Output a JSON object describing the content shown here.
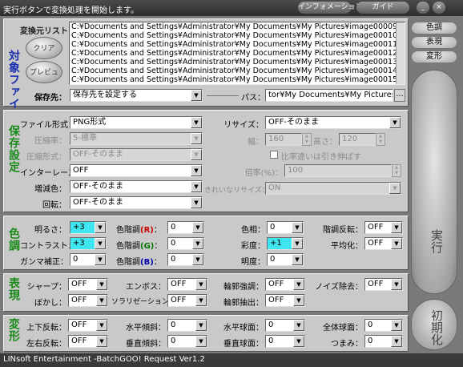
{
  "title": "実行ボタンで変換処理を開始します。",
  "header_buttons": {
    "info": "インフォメーション",
    "guide": "ガイド"
  },
  "side": {
    "tone": "色調",
    "display": "表現",
    "transform": "変形",
    "execute": "実行",
    "reset": "初期化"
  },
  "file": {
    "section": "対象ファイル",
    "list_label": "変換元リスト:",
    "clear": "クリア",
    "preview": "プレビュー",
    "items": [
      "C:¥Documents and Settings¥Administrator¥My Documents¥My Pictures¥image00009",
      "C:¥Documents and Settings¥Administrator¥My Documents¥My Pictures¥image00010",
      "C:¥Documents and Settings¥Administrator¥My Documents¥My Pictures¥image00011",
      "C:¥Documents and Settings¥Administrator¥My Documents¥My Pictures¥image00012",
      "C:¥Documents and Settings¥Administrator¥My Documents¥My Pictures¥image00013",
      "C:¥Documents and Settings¥Administrator¥My Documents¥My Pictures¥image00014",
      "C:¥Documents and Settings¥Administrator¥My Documents¥My Pictures¥image00015"
    ],
    "dest_label": "保存先：",
    "dest_value": "保存先を設定する",
    "path_label": "パス：",
    "path_value": "tor¥My Documents¥My Pictures",
    "browse": "..."
  },
  "save": {
    "section": "保存設定",
    "format_label": "ファイル形式：",
    "format_value": "PNG形式",
    "comp_rate_label": "圧縮率：",
    "comp_rate_value": "5-標準",
    "comp_type_label": "圧縮形式：",
    "comp_type_value": "OFF-そのまま",
    "interlace_label": "インターレース：",
    "interlace_value": "OFF",
    "reduce_label": "増減色：",
    "reduce_value": "OFF-そのまま",
    "rotate_label": "回転：",
    "rotate_value": "OFF-そのまま",
    "resize_label": "リサイズ：",
    "resize_value": "OFF-そのまま",
    "width_label": "幅：",
    "width_value": "160",
    "height_label": "高さ：",
    "height_value": "120",
    "keep_ratio": "比率違いは引き伸ばす",
    "scale_label": "倍率(%)：",
    "scale_value": "100",
    "smooth_label": "きれいなリサイズ：",
    "smooth_value": "ON"
  },
  "tone": {
    "section": "色調",
    "brightness_label": "明るさ：",
    "brightness": "+3",
    "contrast_label": "コントラスト：",
    "contrast": "+3",
    "gamma_label": "ガンマ補正：",
    "gamma": "0",
    "r_label": "色階調",
    "r_mark": "R",
    "r_value": "0",
    "g_label": "色階調",
    "g_mark": "G",
    "g_value": "0",
    "b_label": "色階調",
    "b_mark": "B",
    "b_value": "0",
    "hue_label": "色相：",
    "hue": "0",
    "saturation_label": "彩度：",
    "saturation": "+1",
    "lightness_label": "明度：",
    "lightness": "0",
    "invert_label": "階調反転：",
    "invert": "OFF",
    "equalize_label": "平均化：",
    "equalize": "OFF"
  },
  "effect": {
    "section": "表現",
    "sharp_label": "シャープ：",
    "sharp": "OFF",
    "blur_label": "ぼかし：",
    "blur": "OFF",
    "emboss_label": "エンボス：",
    "emboss": "OFF",
    "solar_label": "ソラリゼーション：",
    "solar": "OFF",
    "edge_enh_label": "輪郭強調：",
    "edge_enh": "OFF",
    "edge_ext_label": "輪郭抽出：",
    "edge_ext": "OFF",
    "noise_label": "ノイズ除去：",
    "noise": "OFF"
  },
  "transform": {
    "section": "変形",
    "flipv_label": "上下反転：",
    "flipv": "OFF",
    "fliph_label": "左右反転：",
    "fliph": "OFF",
    "hskew_label": "水平傾斜：",
    "hskew": "0",
    "vskew_label": "垂直傾斜：",
    "vskew": "0",
    "hsphere_label": "水平球面：",
    "hsphere": "0",
    "vsphere_label": "垂直球面：",
    "vsphere": "0",
    "allsphere_label": "全体球面：",
    "allsphere": "0",
    "pinch_label": "つまみ：",
    "pinch": "0"
  },
  "status": "LINsoft Entertainment -BatchGOO! Request Ver1.2"
}
